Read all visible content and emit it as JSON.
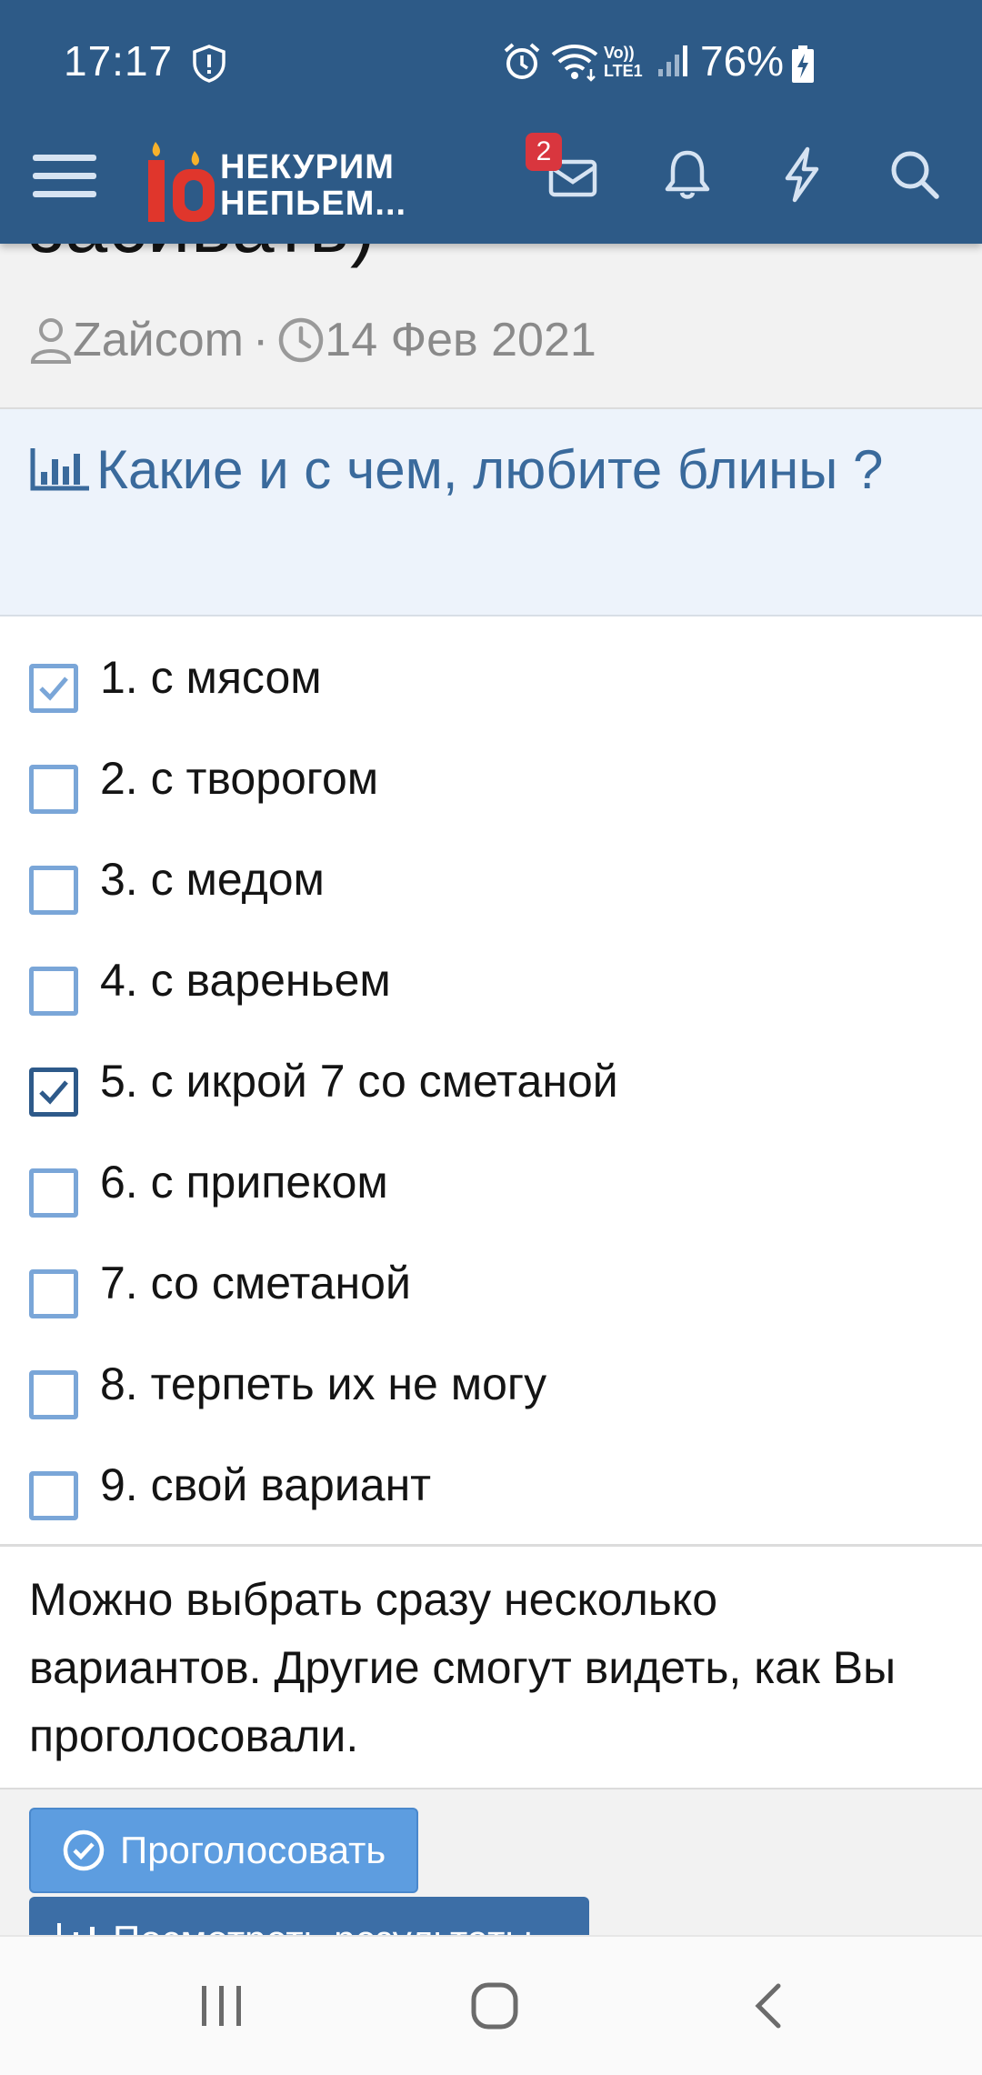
{
  "status_bar": {
    "time": "17:17",
    "network_label_top": "Vo))",
    "network_label_bottom": "LTE1",
    "battery": "76%"
  },
  "header": {
    "logo_line1": "НЕКУРИМ",
    "logo_line2": "НЕПЬЕМ...",
    "logo_glyph": "10",
    "inbox_badge": "2",
    "icons": [
      "menu-icon",
      "envelope-icon",
      "bell-icon",
      "lightning-icon",
      "search-icon"
    ],
    "colors": {
      "background": "#2d5a87",
      "badge": "#d9363e"
    }
  },
  "thread": {
    "title_partial": "засивать)",
    "author": "Zaйcom",
    "date": "14 Фев 2021"
  },
  "poll": {
    "title": "Какие и с чем, любите блины ?",
    "options": [
      {
        "label": "1. с мясом",
        "checked": true
      },
      {
        "label": "2. с творогом",
        "checked": false
      },
      {
        "label": "3. с медом",
        "checked": false
      },
      {
        "label": "4. с вареньем",
        "checked": false
      },
      {
        "label": "5. с икрой 7 со сметаной",
        "checked": true
      },
      {
        "label": "6. с припеком",
        "checked": false
      },
      {
        "label": "7. со сметаной",
        "checked": false
      },
      {
        "label": "8. терпеть их не могу",
        "checked": false
      },
      {
        "label": "9. свой вариант",
        "checked": false
      }
    ],
    "hint": "Можно выбрать сразу несколько вариантов. Другие смогут видеть, как Вы проголосовали.",
    "vote_button": "Проголосовать",
    "results_button": "Посмотреть результаты"
  },
  "colors": {
    "accent": "#3a6a9c",
    "checkbox": "#7aa6d8",
    "vote_button": "#5d9de0"
  }
}
